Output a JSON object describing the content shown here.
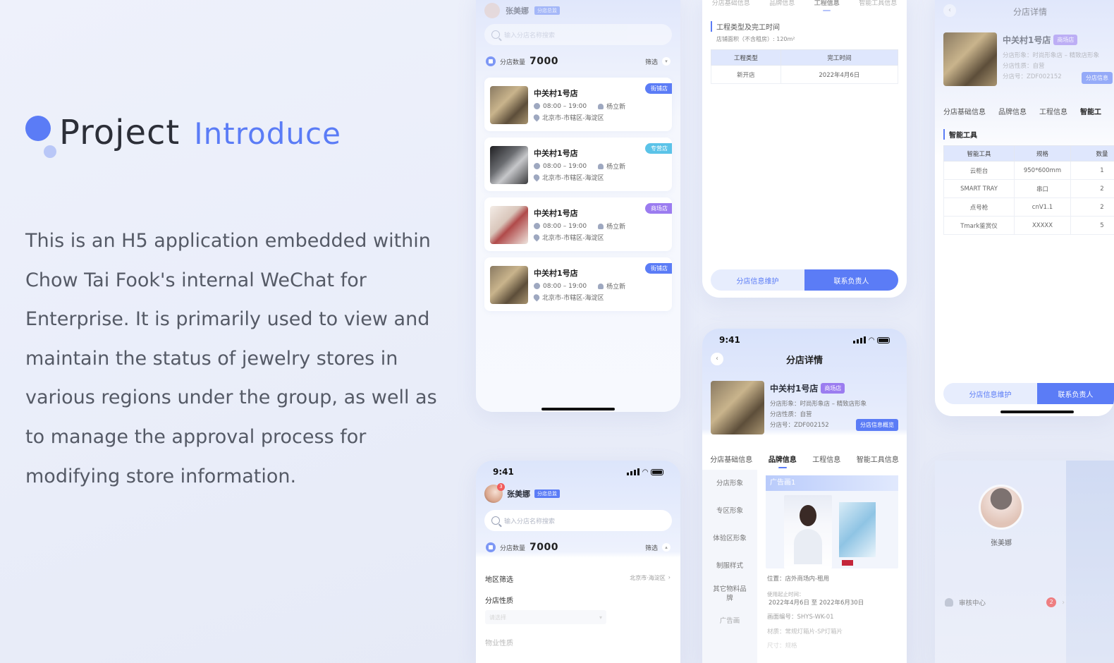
{
  "intro": {
    "title_main": "Project",
    "title_accent": "Introduce",
    "description": "This is an H5 application embedded within Chow Tai Fook's internal WeChat for Enterprise. It is primarily used to view and maintain the status of jewelry stores in various regions under the group, as well as to manage the approval process for modifying store information."
  },
  "colors": {
    "accent": "#5b7cf6",
    "accent_light": "#b9c7f7",
    "tag_cyan": "#5bc3e8",
    "tag_purple": "#9b7cf0"
  },
  "store_list": {
    "user_name": "张美娜",
    "user_role": "分店总监",
    "search_placeholder": "输入分店名称搜索",
    "count_label": "分店数量",
    "count_value": "7000",
    "filter_label": "筛选",
    "stores": [
      {
        "name": "中关村1号店",
        "hours": "08:00 – 19:00",
        "manager": "杨立新",
        "address": "北京市-市辖区-海淀区",
        "tag": "街铺店"
      },
      {
        "name": "中关村1号店",
        "hours": "08:00 – 19:00",
        "manager": "杨立新",
        "address": "北京市-市辖区-海淀区",
        "tag": "专营店"
      },
      {
        "name": "中关村1号店",
        "hours": "08:00 – 19:00",
        "manager": "杨立新",
        "address": "北京市-市辖区-海淀区",
        "tag": "商场店"
      },
      {
        "name": "中关村1号店",
        "hours": "08:00 – 19:00",
        "manager": "杨立新",
        "address": "北京市-市辖区-海淀区",
        "tag": "街铺店"
      }
    ]
  },
  "engineering": {
    "top_tabs": [
      "分店基础信息",
      "品牌信息",
      "工程信息",
      "智能工具信息"
    ],
    "section_title": "工程类型及完工时间",
    "area_note": "店铺面积（不含租房）: 120m²",
    "table_headers": [
      "工程类型",
      "完工时间"
    ],
    "table_rows": [
      [
        "新开店",
        "2022年4月6日"
      ]
    ],
    "btn_maintain": "分店信息维护",
    "btn_contact": "联系负责人"
  },
  "detail": {
    "time": "9:41",
    "title": "分店详情",
    "store_name": "中关村1号店",
    "store_tag": "商场店",
    "image_type": "分店形象：时尚形象店 – 精致店形象",
    "nature": "分店性质：自营",
    "store_no": "分店号：ZDF002152",
    "preview_btn": "分店信息概览",
    "tabs": [
      "分店基础信息",
      "品牌信息",
      "工程信息",
      "智能工具信息"
    ],
    "side_nav": [
      "分店形象",
      "专区形象",
      "体验区形象",
      "制服样式",
      "其它物料品牌",
      "广告画"
    ],
    "ad_title": "广告画1",
    "location": "位置：店外商场内-租用",
    "period_label": "使用起止时间：",
    "period_value": "2022年4月6日 至 2022年6月30日",
    "ad_no": "画面编号：SHYS-WK-01",
    "material": "材质：常规灯箱片-SP灯箱片",
    "size": "尺寸：规格"
  },
  "filter_page": {
    "time": "9:41",
    "user_name": "张美娜",
    "user_role": "分店总监",
    "badge": "3",
    "search_placeholder": "输入分店名称搜索",
    "count_label": "分店数量",
    "count_value": "7000",
    "filter_label": "筛选",
    "region_label": "地区筛选",
    "region_value": "北京市·海淀区",
    "nature_label": "分店性质",
    "nature_placeholder": "请选择",
    "property_label": "物业性质"
  },
  "tools": {
    "title": "分店详情",
    "store_name": "中关村1号店",
    "store_tag": "商场店",
    "image_type": "分店形象：时尚形象店 – 精致店形象",
    "nature": "分店性质：自营",
    "store_no": "分店号：ZDF002152",
    "preview_btn": "分店信息",
    "tabs": [
      "分店基础信息",
      "品牌信息",
      "工程信息",
      "智能工"
    ],
    "section_title": "智能工具",
    "headers": [
      "智能工具",
      "规格",
      "数量"
    ],
    "rows": [
      [
        "云柜台",
        "950*600mm",
        "1"
      ],
      [
        "SMART TRAY",
        "串口",
        "2"
      ],
      [
        "点号枪",
        "cnV1.1",
        "2"
      ],
      [
        "Tmark鉴赏仪",
        "XXXXX",
        "5"
      ]
    ],
    "btn_maintain": "分店信息维护",
    "btn_contact": "联系负责人"
  },
  "profile": {
    "name": "张美娜",
    "approval_label": "审核中心",
    "approval_badge": "2"
  }
}
